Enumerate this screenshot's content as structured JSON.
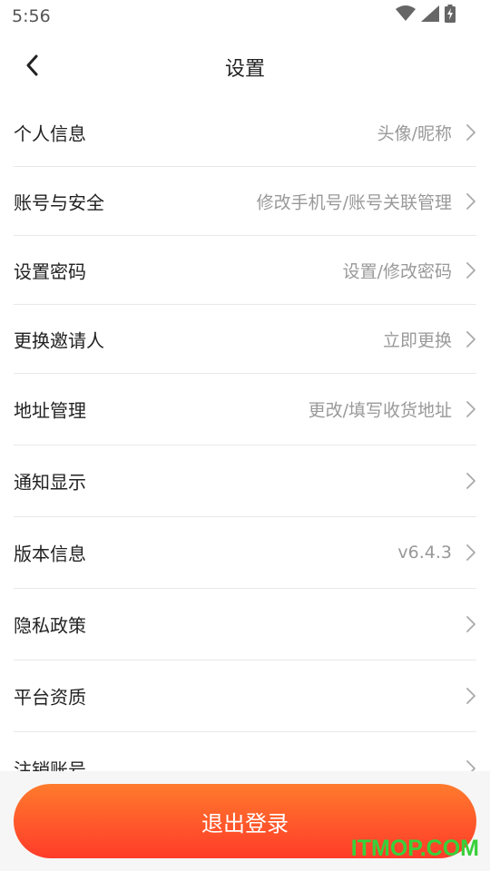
{
  "status_bar": {
    "time": "5:56",
    "icons": [
      "wifi-icon",
      "signal-icon",
      "battery-charging-icon"
    ]
  },
  "header": {
    "back_icon": "chevron-left-icon",
    "title": "设置"
  },
  "settings": [
    {
      "label": "个人信息",
      "value": "头像/昵称"
    },
    {
      "label": "账号与安全",
      "value": "修改手机号/账号关联管理"
    },
    {
      "label": "设置密码",
      "value": "设置/修改密码"
    },
    {
      "label": "更换邀请人",
      "value": "立即更换"
    },
    {
      "label": "地址管理",
      "value": "更改/填写收货地址"
    },
    {
      "label": "通知显示",
      "value": ""
    },
    {
      "label": "版本信息",
      "value": "v6.4.3"
    },
    {
      "label": "隐私政策",
      "value": ""
    },
    {
      "label": "平台资质",
      "value": ""
    },
    {
      "label": "注销账号",
      "value": ""
    }
  ],
  "footer": {
    "logout_label": "退出登录"
  },
  "watermark": "ITMOP.COM",
  "colors": {
    "accent_start": "#ff7b2c",
    "accent_end": "#ff3b2a",
    "secondary_text": "#999999",
    "watermark": "#36d13a"
  }
}
